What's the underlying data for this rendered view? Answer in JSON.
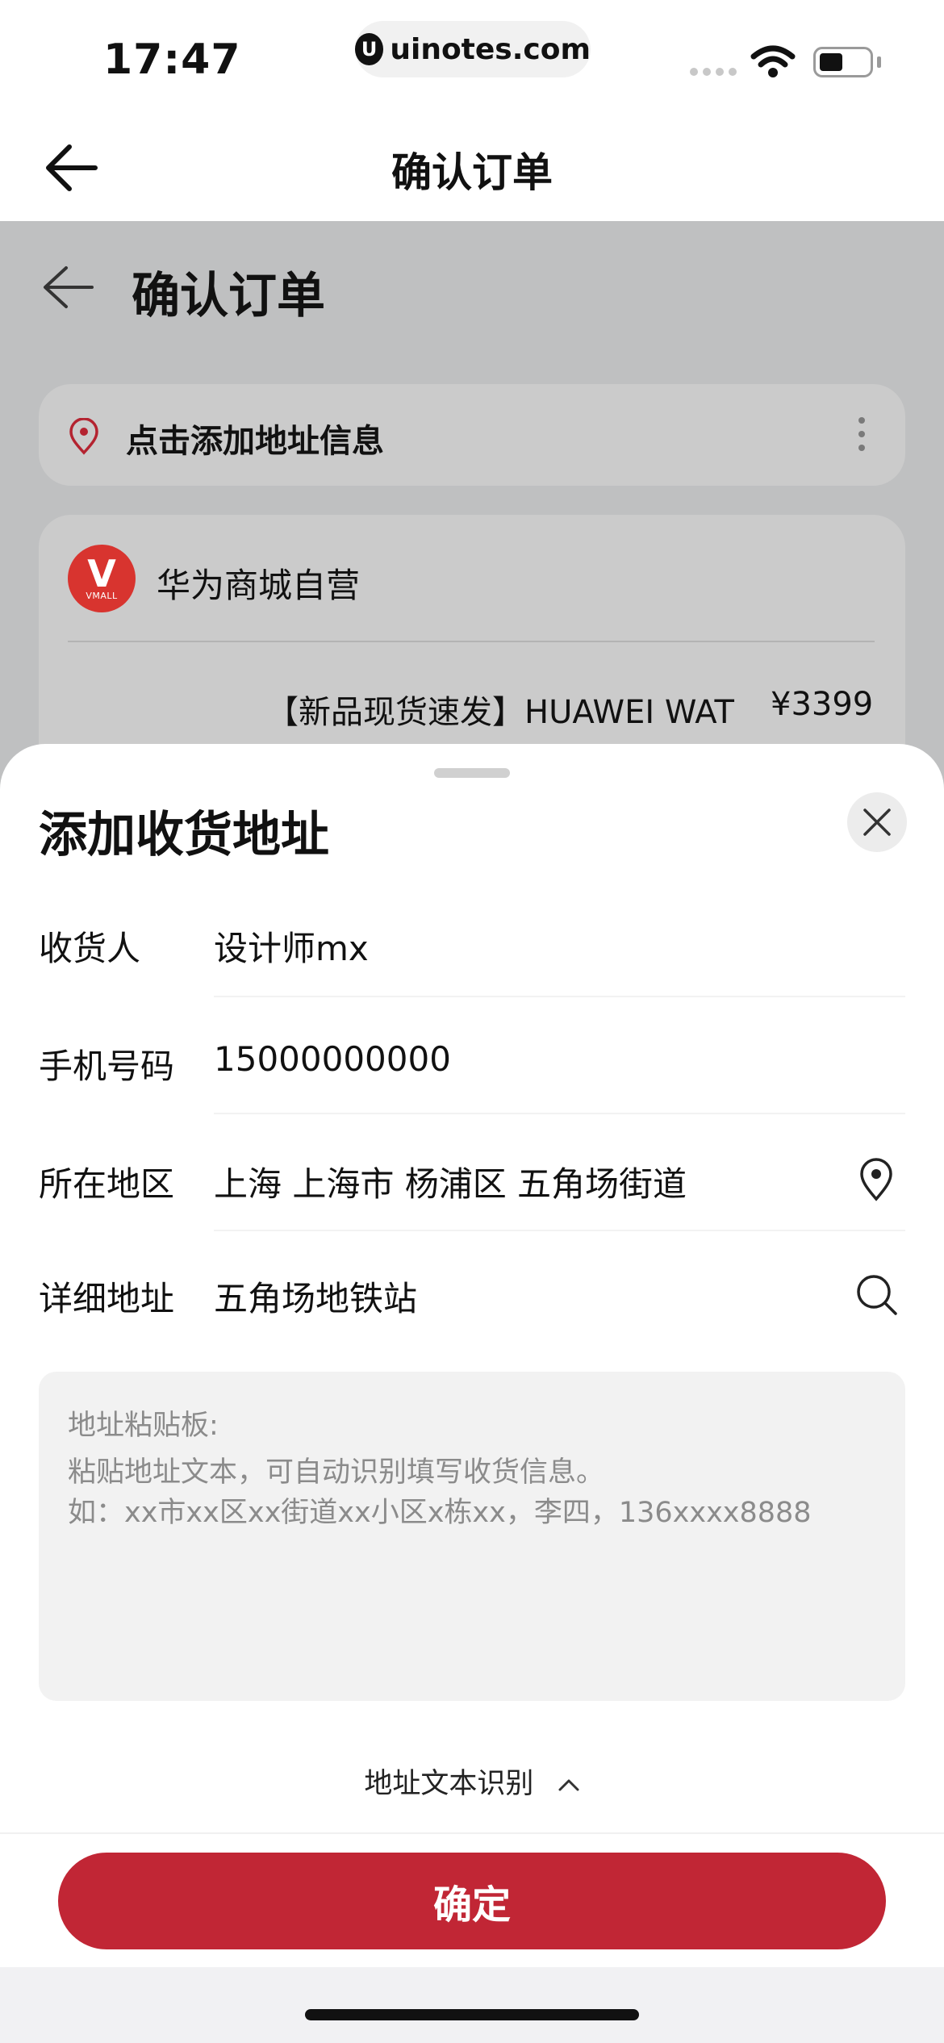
{
  "status_bar": {
    "time": "17:47",
    "site": "uinotes.com",
    "site_logo": "U",
    "battery_level": 0.45
  },
  "nav": {
    "title": "确认订单"
  },
  "background_page": {
    "title": "确认订单",
    "address_prompt": "点击添加地址信息",
    "shop": {
      "logo_text": "V",
      "logo_subtext": "VMALL",
      "name": "华为商城自营"
    },
    "product": {
      "name": "【新品现货速发】HUAWEI WAT",
      "price": "¥3399"
    }
  },
  "sheet": {
    "title": "添加收货地址",
    "fields": [
      {
        "label": "收货人",
        "value": "设计师mx"
      },
      {
        "label": "手机号码",
        "value": "15000000000"
      },
      {
        "label": "所在地区",
        "value": "上海 上海市 杨浦区 五角场街道"
      },
      {
        "label": "详细地址",
        "value": "五角场地铁站"
      }
    ],
    "clipboard": {
      "title": "地址粘贴板:",
      "hint_line1": "粘贴地址文本，可自动识别填写收货信息。",
      "hint_line2": "如：xx市xx区xx街道xx小区x栋xx，李四，136xxxx8888"
    },
    "recognize_label": "地址文本识别",
    "confirm_label": "确定"
  },
  "colors": {
    "accent": "#c12635",
    "overlay": "#bfc0c1",
    "vmall_red": "#d8342f"
  },
  "icons": [
    "back-arrow-icon",
    "location-pin-icon",
    "more-vertical-icon",
    "close-icon",
    "search-icon",
    "chevron-up-icon",
    "wifi-icon",
    "battery-icon"
  ]
}
